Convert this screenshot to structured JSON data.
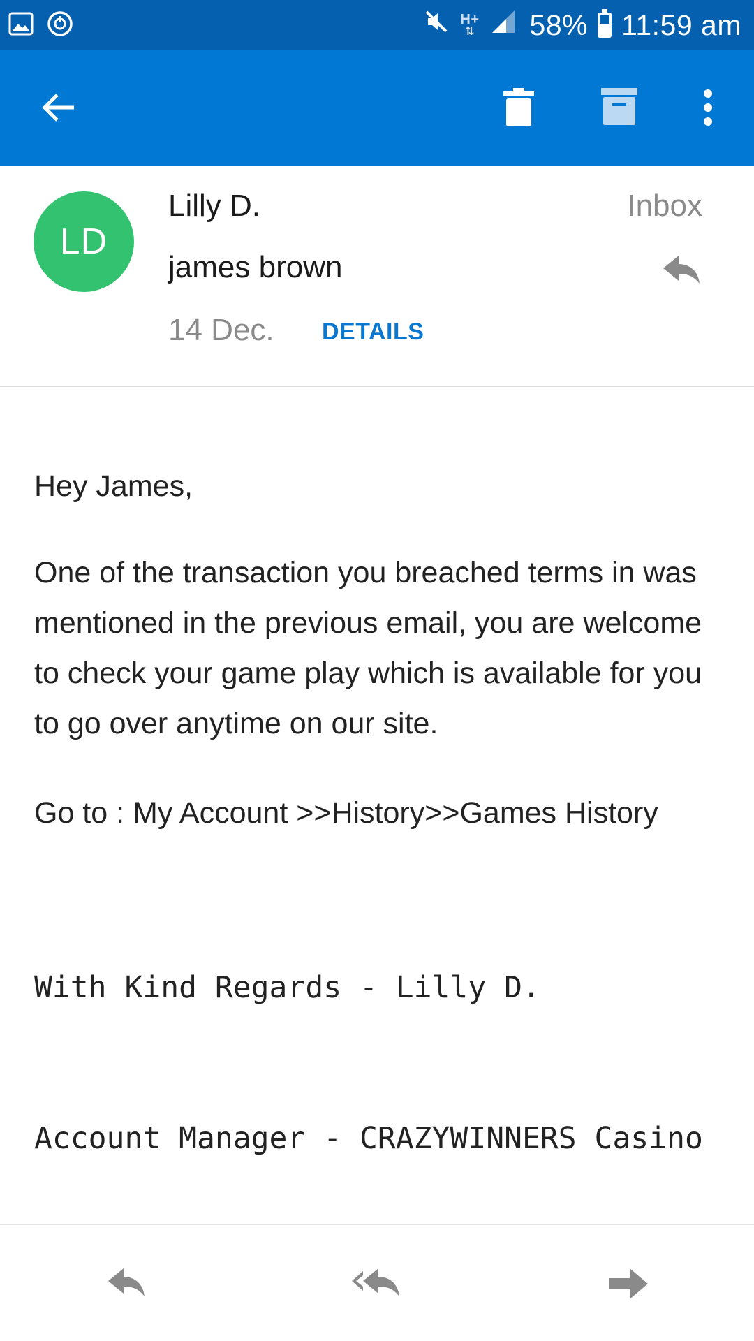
{
  "status_bar": {
    "left_icons": [
      "gallery-icon",
      "sync-icon"
    ],
    "right_icons": [
      "mute-icon",
      "network-type-icon",
      "signal-icon",
      "battery-icon"
    ],
    "network_type": "H+",
    "battery_percent": "58%",
    "battery_level": 0.58,
    "time": "11:59 am"
  },
  "app_bar": {
    "icons": [
      "back-arrow-icon",
      "delete-icon",
      "archive-icon",
      "more-icon"
    ],
    "color": "#0178d4"
  },
  "header": {
    "avatar_initials": "LD",
    "avatar_color": "#33c370",
    "sender": "Lilly D.",
    "recipient": "james brown",
    "date": "14 Dec.",
    "details_label": "DETAILS",
    "folder": "Inbox",
    "reply_icon": "reply-icon"
  },
  "body": {
    "greeting": "Hey James,",
    "paragraph": "One of the transaction you breached terms in was mentioned in the previous email, you are welcome to check your game play which is available for you to go over anytime on our site.",
    "goto": "Go to : My Account >>History>>Games History",
    "signature_line1": "With Kind Regards - Lilly D.",
    "signature_line2": "Account Manager - CRAZYWINNERS Casino"
  },
  "bottom_bar": {
    "icons": [
      "reply-icon",
      "reply-all-icon",
      "forward-icon"
    ]
  }
}
